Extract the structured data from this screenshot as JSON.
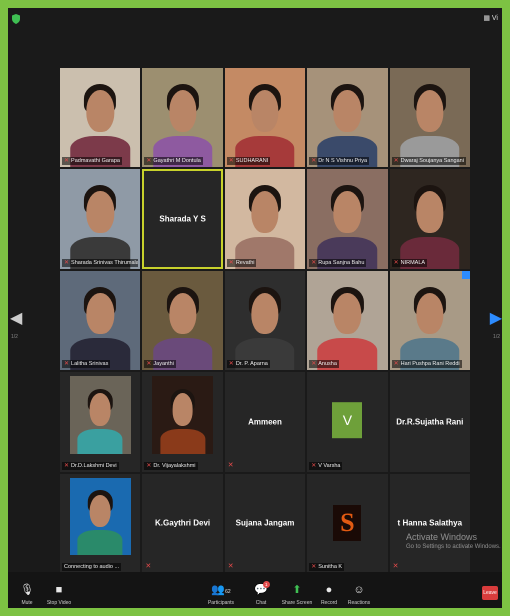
{
  "top": {
    "view_label": "Vi"
  },
  "nav": {
    "page_left": "1/2",
    "page_right": "1/2"
  },
  "participants": [
    {
      "name": "Padmavathi Garapa",
      "muted": true,
      "video": true,
      "bg": "#cbbfae",
      "shirt": "#7c3a4a"
    },
    {
      "name": "Gayathri M Dontula",
      "muted": true,
      "video": true,
      "bg": "#9c8f70",
      "shirt": "#8e5aa0"
    },
    {
      "name": "SUDHARANI",
      "muted": true,
      "video": true,
      "bg": "#c48a64",
      "shirt": "#a63a3a"
    },
    {
      "name": "Dr N S Vishnu Priya",
      "muted": true,
      "video": true,
      "bg": "#a6927a",
      "shirt": "#3a4a6a"
    },
    {
      "name": "Dwaraj Soujanya Sangani",
      "muted": true,
      "video": true,
      "bg": "#7a6a56",
      "shirt": "#9a9a9a"
    },
    {
      "name": "Sharada Srinivas Thirumala",
      "muted": true,
      "video": true,
      "bg": "#8f9aa6",
      "shirt": "#3a3a3a"
    },
    {
      "name": "Sharada Y S",
      "muted": false,
      "video": false,
      "active": true
    },
    {
      "name": "Revathi",
      "muted": true,
      "video": true,
      "bg": "#d2b8a0",
      "shirt": "#a0786a"
    },
    {
      "name": "Rupa Sanjna Bahu",
      "muted": true,
      "video": true,
      "bg": "#8a6e62",
      "shirt": "#4a3a5a"
    },
    {
      "name": "NIRMALA",
      "muted": true,
      "video": true,
      "bg": "#2e2620",
      "shirt": "#6a2a3a"
    },
    {
      "name": "Lalitha Srinivas",
      "muted": true,
      "video": true,
      "bg": "#5e6a7a",
      "shirt": "#2a2a3a"
    },
    {
      "name": "Jayanthi",
      "muted": true,
      "video": true,
      "bg": "#6a5a3e",
      "shirt": "#6a4a7a"
    },
    {
      "name": "Dr. P. Aparna",
      "muted": true,
      "video": true,
      "bg": "#2e2e2e",
      "shirt": "#3a3a3a"
    },
    {
      "name": "Anusha",
      "muted": true,
      "video": true,
      "bg": "#b0a496",
      "shirt": "#c84a4a"
    },
    {
      "name": "Hari Pushpa Rani Reddi",
      "muted": true,
      "video": true,
      "bg": "#a89a86",
      "shirt": "#5a7a8a",
      "pip": true
    },
    {
      "name": "Dr.D.Lakshmi Devi",
      "muted": true,
      "video": true,
      "bg": "#6a6458",
      "shirt": "#3aa0a0",
      "framed": true
    },
    {
      "name": "Dr. Vijayalakshmi",
      "muted": true,
      "video": true,
      "bg": "#2a1a14",
      "shirt": "#8a3a1a",
      "framed": true
    },
    {
      "name": "Ammeen",
      "muted": true,
      "video": false
    },
    {
      "name": "V Varsha",
      "muted": true,
      "video": false,
      "avatar": "V"
    },
    {
      "name": "Dr.R.Sujatha Rani",
      "muted": false,
      "video": false
    },
    {
      "name": "Connecting to audio ...",
      "muted": false,
      "video": true,
      "bg": "#1a6ab0",
      "shirt": "#2a8a6a",
      "framed": true
    },
    {
      "name": "K.Gaythri Devi",
      "muted": true,
      "video": false
    },
    {
      "name": "Sujana Jangam",
      "muted": true,
      "video": false
    },
    {
      "name": "Sunitha K",
      "muted": true,
      "video": false,
      "avatar_s": "S"
    },
    {
      "name": "Hanna Salathya",
      "muted": true,
      "video": false,
      "prefix": "t"
    }
  ],
  "watermark": {
    "line1": "Activate Windows",
    "line2": "Go to Settings to activate Windows."
  },
  "toolbar": {
    "mute": "Mute",
    "stop_video": "Stop Video",
    "participants": "Participants",
    "participants_count": "62",
    "chat": "Chat",
    "chat_badge": "1",
    "share_screen": "Share Screen",
    "record": "Record",
    "reactions": "Reactions",
    "leave": "Leave"
  }
}
